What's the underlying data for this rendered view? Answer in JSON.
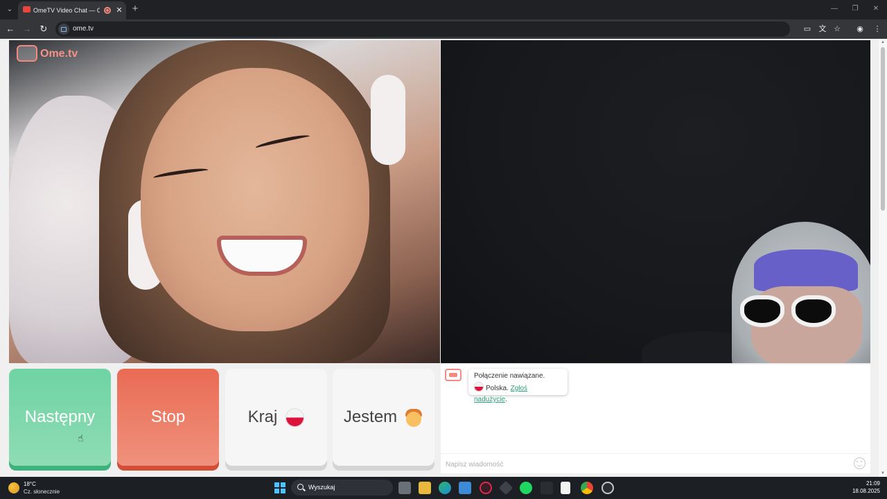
{
  "browser": {
    "tab_title": "OmeTV Video Chat — Ome",
    "tab_close": "✕",
    "new_tab": "+",
    "url": "ome.tv"
  },
  "page": {
    "logo_text": "Ome.tv",
    "buttons": {
      "next": "Następny",
      "stop": "Stop",
      "country": "Kraj",
      "gender": "Jestem"
    },
    "chat": {
      "status": "Połączenie nawiązane.",
      "country": "Polska.",
      "report_link": "Zgłoś nadużycie",
      "report_suffix": ".",
      "input_placeholder": "Napisz wiadomość"
    }
  },
  "taskbar": {
    "weather_temp": "18°C",
    "weather_desc": "Cz. słonecznie",
    "search_label": "Wyszukaj",
    "time": "21:09",
    "date": "18.08.2025"
  },
  "icons": [
    "tab-search-icon",
    "favicon-icon",
    "recording-icon",
    "back-icon",
    "forward-icon",
    "reload-icon",
    "site-info-icon",
    "cast-icon",
    "translate-icon",
    "bookmark-star-icon",
    "profile-icon",
    "menu-kebab-icon",
    "smiley-icon",
    "weather-icon",
    "windows-start-icon",
    "search-icon",
    "poland-flag-icon",
    "boy-emoji-icon",
    "hand-cursor-icon"
  ]
}
